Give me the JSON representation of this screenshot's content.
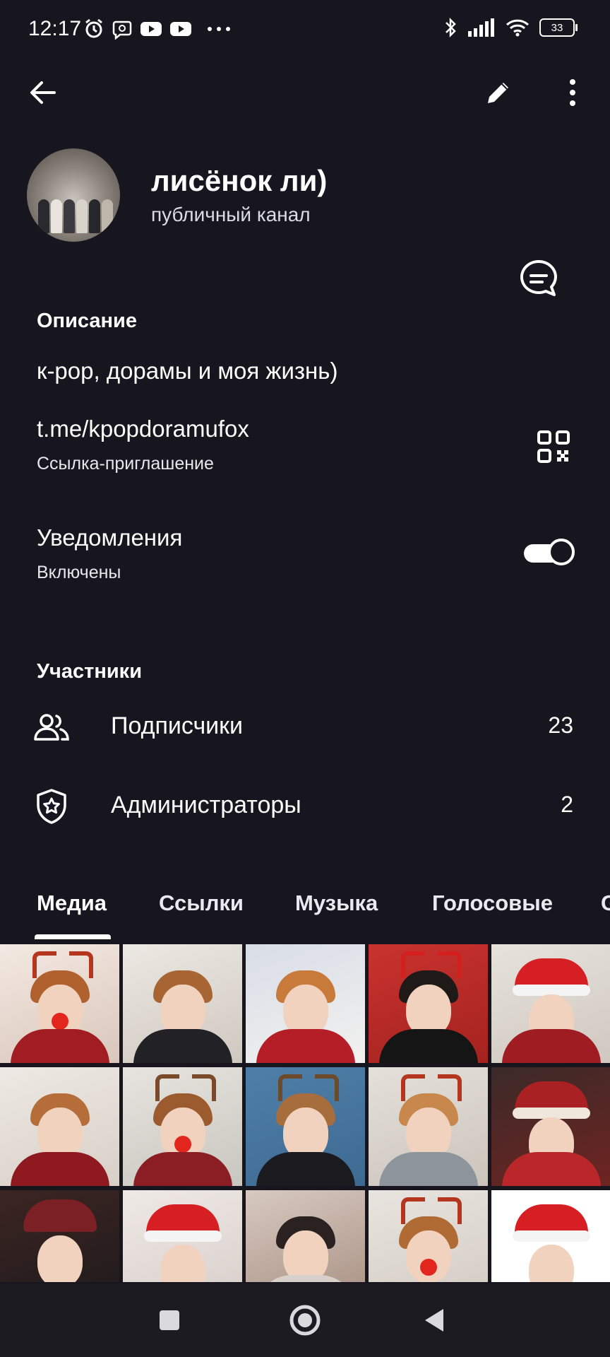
{
  "status_bar": {
    "time": "12:17",
    "battery": "33",
    "left_icons": [
      "alarm-icon",
      "viber-icon",
      "youtube-icon",
      "youtube-icon",
      "more-dots-icon"
    ],
    "right_icons": [
      "bluetooth-icon",
      "signal-icon",
      "wifi-icon",
      "battery-icon"
    ]
  },
  "top_bar": {
    "icons": [
      "back-arrow-icon",
      "edit-pencil-icon",
      "more-vertical-icon"
    ]
  },
  "channel": {
    "name": "лисёнок ли)",
    "type": "публичный канал"
  },
  "description": {
    "heading": "Описание",
    "text": "к-pop, дорамы и моя жизнь)"
  },
  "invite": {
    "link": "t.me/kpopdoramufox",
    "label": "Ссылка-приглашение"
  },
  "notifications": {
    "title": "Уведомления",
    "status": "Включены",
    "enabled": true
  },
  "members": {
    "heading": "Участники",
    "rows": [
      {
        "label": "Подписчики",
        "count": "23",
        "icon": "people-icon"
      },
      {
        "label": "Администраторы",
        "count": "2",
        "icon": "shield-star-icon"
      }
    ]
  },
  "tabs": [
    "Медиа",
    "Ссылки",
    "Музыка",
    "Голосовые",
    "G"
  ],
  "active_tab": "Медиа",
  "media_grid": {
    "rows": 3,
    "columns": 5,
    "items": 15
  },
  "nav_bar": {
    "icons": [
      "recents-square-icon",
      "home-circle-icon",
      "back-triangle-icon"
    ]
  },
  "colors": {
    "background": "#17161f",
    "text": "#ffffff",
    "nav_background": "#1c1b21"
  }
}
